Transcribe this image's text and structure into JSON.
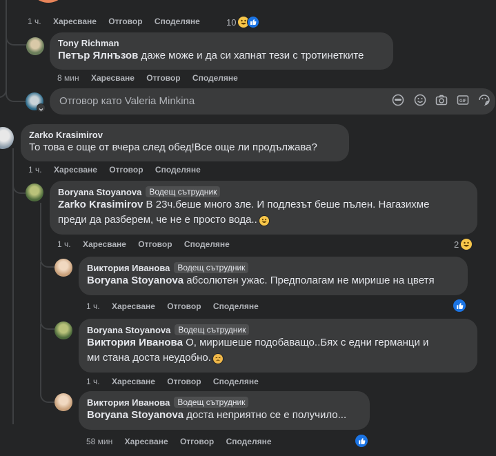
{
  "top_row": {
    "time": "1 ч.",
    "like": "Харесване",
    "reply": "Отговор",
    "share": "Споделяне",
    "reaction_count": "10"
  },
  "composer": {
    "placeholder": "Отговор като Valeria Minkina"
  },
  "comments": [
    {
      "author": "Tony Richman",
      "badge": "",
      "mention": "Петър Ялнъзов",
      "text": " даже може и да си хапнат тези с тротинетките",
      "text2": "",
      "time": "8 мин",
      "like": "Харесване",
      "reply": "Отговор",
      "share": "Споделяне",
      "reaction_count": ""
    },
    {
      "author": "Zarko Krasimirov",
      "badge": "",
      "mention": "",
      "text": "То това е още от вчера след обед!Все още ли продължава?",
      "text2": "",
      "time": "1 ч.",
      "like": "Харесване",
      "reply": "Отговор",
      "share": "Споделяне",
      "reaction_count": ""
    },
    {
      "author": "Boryana Stoyanova",
      "badge": "Водещ сътрудник",
      "mention": "Zarko Krasimirov",
      "text": " В 23ч.беше много зле. И подлезът беше пълен. Нагазихме",
      "text2": "преди да разберем, че не е просто вода..",
      "time": "1 ч.",
      "like": "Харесване",
      "reply": "Отговор",
      "share": "Споделяне",
      "reaction_count": "2"
    },
    {
      "author": "Виктория Иванова",
      "badge": "Водещ сътрудник",
      "mention": "Boryana Stoyanova",
      "text": " абсолютен ужас. Предполагам не мирише на цветя",
      "text2": "",
      "time": "1 ч.",
      "like": "Харесване",
      "reply": "Отговор",
      "share": "Споделяне",
      "reaction_count": ""
    },
    {
      "author": "Boryana Stoyanova",
      "badge": "Водещ сътрудник",
      "mention": "Виктория Иванова",
      "text": " О, миришеше подобаващо..Бях с едни германци и",
      "text2": "ми стана доста неудобно.",
      "time": "1 ч.",
      "like": "Харесване",
      "reply": "Отговор",
      "share": "Споделяне",
      "reaction_count": ""
    },
    {
      "author": "Виктория Иванова",
      "badge": "Водещ сътрудник",
      "mention": "Boryana Stoyanova",
      "text": " доста неприятно се е получило...",
      "text2": "",
      "time": "58 мин",
      "like": "Харесване",
      "reply": "Отговор",
      "share": "Споделяне",
      "reaction_count": ""
    }
  ],
  "colors": {
    "background": "#242526",
    "bubble": "#3a3b3c",
    "text": "#e4e6eb",
    "muted": "#b0b3b8",
    "like_blue": "#1b74e4",
    "haha_yellow": "#f7c64a"
  },
  "icons": [
    "haha-reaction-icon",
    "like-reaction-icon",
    "avatar-sticker-icon",
    "emoji-icon",
    "camera-icon",
    "gif-icon",
    "sticker-icon"
  ]
}
